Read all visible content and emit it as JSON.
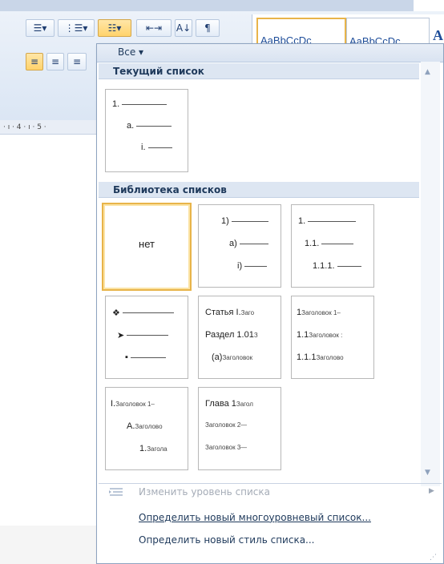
{
  "ribbon": {
    "styles": [
      "AaBbCcDc",
      "AaBbCcDc"
    ],
    "big_a": "A",
    "pilcrow": "¶"
  },
  "ruler": {
    "text": "· ı · 4 · ı · 5 ·"
  },
  "dropdown": {
    "filter_label": "Все ▾",
    "current_list_title": "Текущий список",
    "library_title": "Библиотека списков",
    "current_tile": {
      "lines": [
        "1.",
        "a.",
        "i."
      ]
    },
    "library_tiles": [
      {
        "type": "none",
        "label": "нет"
      },
      {
        "type": "numbered",
        "lines": [
          "1)",
          "a)",
          "i)"
        ]
      },
      {
        "type": "numbered",
        "lines": [
          "1.",
          "1.1.",
          "1.1.1."
        ]
      },
      {
        "type": "bullets",
        "lines": [
          "❖",
          "➤",
          "▪"
        ]
      },
      {
        "type": "headings",
        "lines": [
          {
            "label": "Статья I.",
            "small": "Заго"
          },
          {
            "label": "Раздел 1.01",
            "small": "З"
          },
          {
            "label": "(а)",
            "small": "Заголовок"
          }
        ]
      },
      {
        "type": "headings",
        "lines": [
          {
            "label": "1",
            "small": "Заголовок 1–"
          },
          {
            "label": "1.1",
            "small": "Заголовок :"
          },
          {
            "label": "1.1.1",
            "small": "Заголово"
          }
        ]
      },
      {
        "type": "headings",
        "lines": [
          {
            "label": "I.",
            "small": "Заголовок 1–"
          },
          {
            "label": "A.",
            "small": "Заголово"
          },
          {
            "label": "1.",
            "small": "Загола"
          }
        ]
      },
      {
        "type": "headings",
        "lines": [
          {
            "label": "Глава 1",
            "small": "Загол"
          },
          {
            "label": "",
            "small": "Заголовок 2—"
          },
          {
            "label": "",
            "small": "Заголовок 3—"
          }
        ]
      }
    ],
    "menu": {
      "change_level": "Изменить уровень списка",
      "define_multilevel": "Определить новый многоуровневый список...",
      "define_style": "Определить новый стиль списка..."
    }
  }
}
